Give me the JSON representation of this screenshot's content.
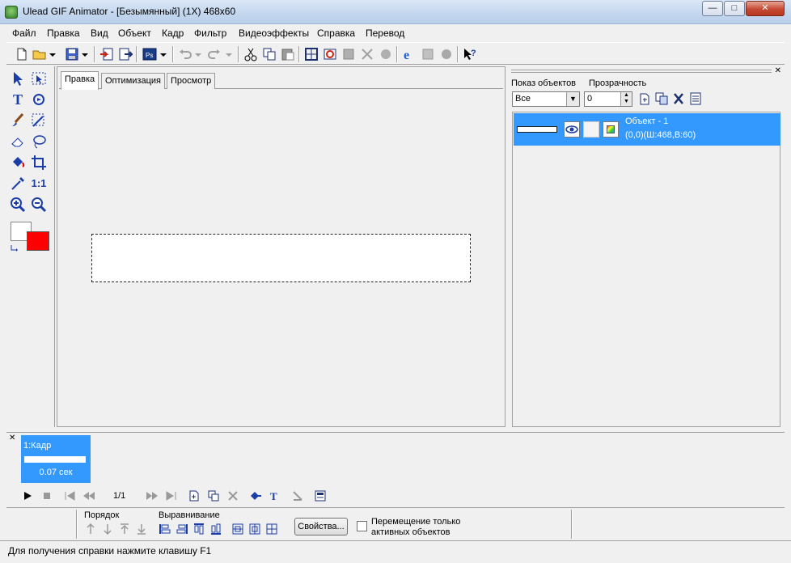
{
  "window": {
    "title": "Ulead GIF Animator - [Безымянный] (1X) 468x60"
  },
  "menu": [
    "Файл",
    "Правка",
    "Вид",
    "Объект",
    "Кадр",
    "Фильтр",
    "Видеоэффекты",
    "Справка",
    "Перевод"
  ],
  "editor": {
    "tabs": [
      {
        "label": "Правка",
        "active": true
      },
      {
        "label": "Оптимизация",
        "active": false
      },
      {
        "label": "Просмотр",
        "active": false
      }
    ]
  },
  "tools": {
    "actual_size_label": "1:1"
  },
  "colors": {
    "foreground": "#ff0000",
    "background": "#ffffff",
    "selection": "#3399ff"
  },
  "objects_panel": {
    "show_label": "Показ объектов",
    "opacity_label": "Прозрачность",
    "show_value": "Все",
    "opacity_value": "0",
    "items": [
      {
        "name": "Объект - 1",
        "info": "(0,0)(Ш:468,В:60)"
      }
    ]
  },
  "frames": {
    "items": [
      {
        "label": "1:Кадр",
        "delay": "0.07 сек"
      }
    ],
    "page_indicator": "1/1"
  },
  "bottom": {
    "order_label": "Порядок",
    "align_label": "Выравнивание",
    "properties_button": "Свойства...",
    "move_active_only_label_1": "Перемещение только",
    "move_active_only_label_2": "активных объектов"
  },
  "status": {
    "text": "Для получения справки нажмите клавишу F1"
  }
}
